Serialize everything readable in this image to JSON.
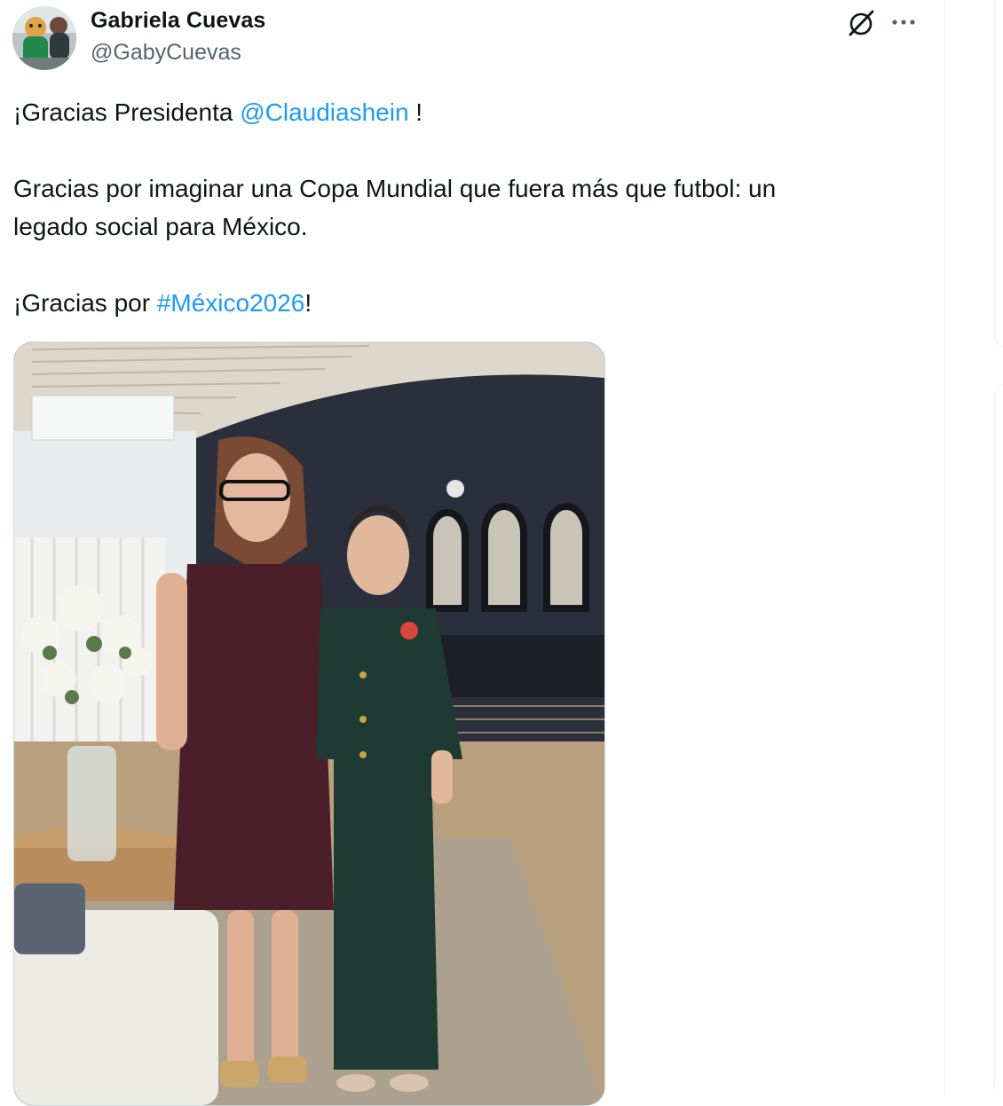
{
  "post": {
    "author": {
      "name": "Gabriela Cuevas",
      "handle": "@GabyCuevas",
      "avatar_icon": "avatar-photo"
    },
    "header_icons": {
      "grok": "grok-icon",
      "more": "more-icon"
    },
    "text": {
      "line1_prefix": "¡Gracias Presidenta ",
      "line1_mention": "@Claudiashein",
      "line1_suffix": " !",
      "line2": "Gracias por imaginar una Copa Mundial que fuera más que futbol: un",
      "line3": "legado social para México.",
      "line4_prefix": "¡Gracias por ",
      "line4_hashtag": "#México2026",
      "line4_suffix": "!"
    },
    "media": {
      "kind": "photo"
    }
  },
  "colors": {
    "text": "#0f1419",
    "secondary": "#536471",
    "link": "#1d9bf0",
    "border": "#cfd9de"
  }
}
